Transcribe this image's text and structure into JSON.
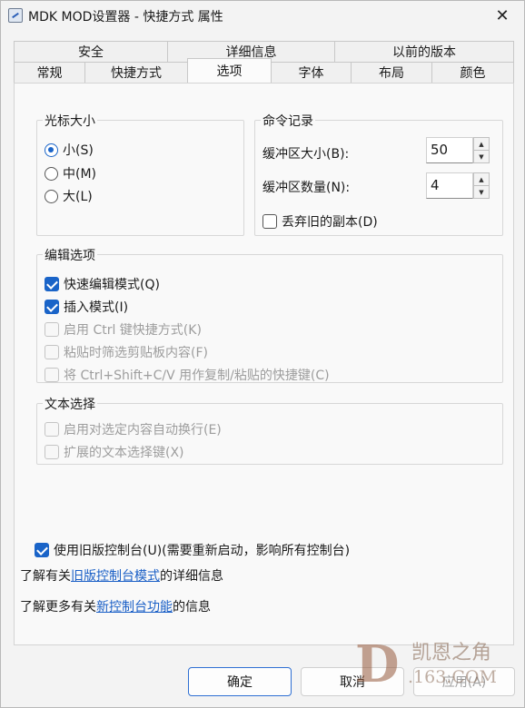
{
  "window": {
    "title": "MDK MOD设置器 - 快捷方式 属性",
    "close": "✕"
  },
  "tabs": {
    "upper": [
      "安全",
      "详细信息",
      "以前的版本"
    ],
    "lower": [
      "常规",
      "快捷方式",
      "选项",
      "字体",
      "布局",
      "颜色"
    ],
    "active": "选项"
  },
  "cursor_size": {
    "label": "光标大小",
    "options": [
      "小(S)",
      "中(M)",
      "大(L)"
    ],
    "selected": "小(S)"
  },
  "command_history": {
    "label": "命令记录",
    "buffer_size_label": "缓冲区大小(B):",
    "buffer_size_value": "50",
    "buffer_count_label": "缓冲区数量(N):",
    "buffer_count_value": "4",
    "discard_old_label": "丢弃旧的副本(D)",
    "discard_old_checked": false
  },
  "edit_options": {
    "label": "编辑选项",
    "items": [
      {
        "label": "快速编辑模式(Q)",
        "checked": true,
        "enabled": true
      },
      {
        "label": "插入模式(I)",
        "checked": true,
        "enabled": true
      },
      {
        "label": "启用 Ctrl 键快捷方式(K)",
        "checked": false,
        "enabled": false
      },
      {
        "label": "粘贴时筛选剪贴板内容(F)",
        "checked": false,
        "enabled": false
      },
      {
        "label": "将 Ctrl+Shift+C/V 用作复制/粘贴的快捷键(C)",
        "checked": false,
        "enabled": false
      }
    ]
  },
  "text_selection": {
    "label": "文本选择",
    "items": [
      {
        "label": "启用对选定内容自动换行(E)",
        "checked": false,
        "enabled": false
      },
      {
        "label": "扩展的文本选择键(X)",
        "checked": false,
        "enabled": false
      }
    ]
  },
  "legacy": {
    "label": "使用旧版控制台(U)(需要重新启动，影响所有控制台)",
    "checked": true,
    "info1_prefix": "了解有关",
    "info1_link": "旧版控制台模式",
    "info1_suffix": "的详细信息",
    "info2_prefix": "了解更多有关",
    "info2_link": "新控制台功能",
    "info2_suffix": "的信息"
  },
  "buttons": {
    "ok": "确定",
    "cancel": "取消",
    "apply": "应用(A)"
  },
  "watermark": {
    "logo": "D",
    "text": "凯恩之角",
    "sub": ".163.COM"
  },
  "colors": {
    "accent": "#1a64c8",
    "link": "#1a5fc6"
  }
}
